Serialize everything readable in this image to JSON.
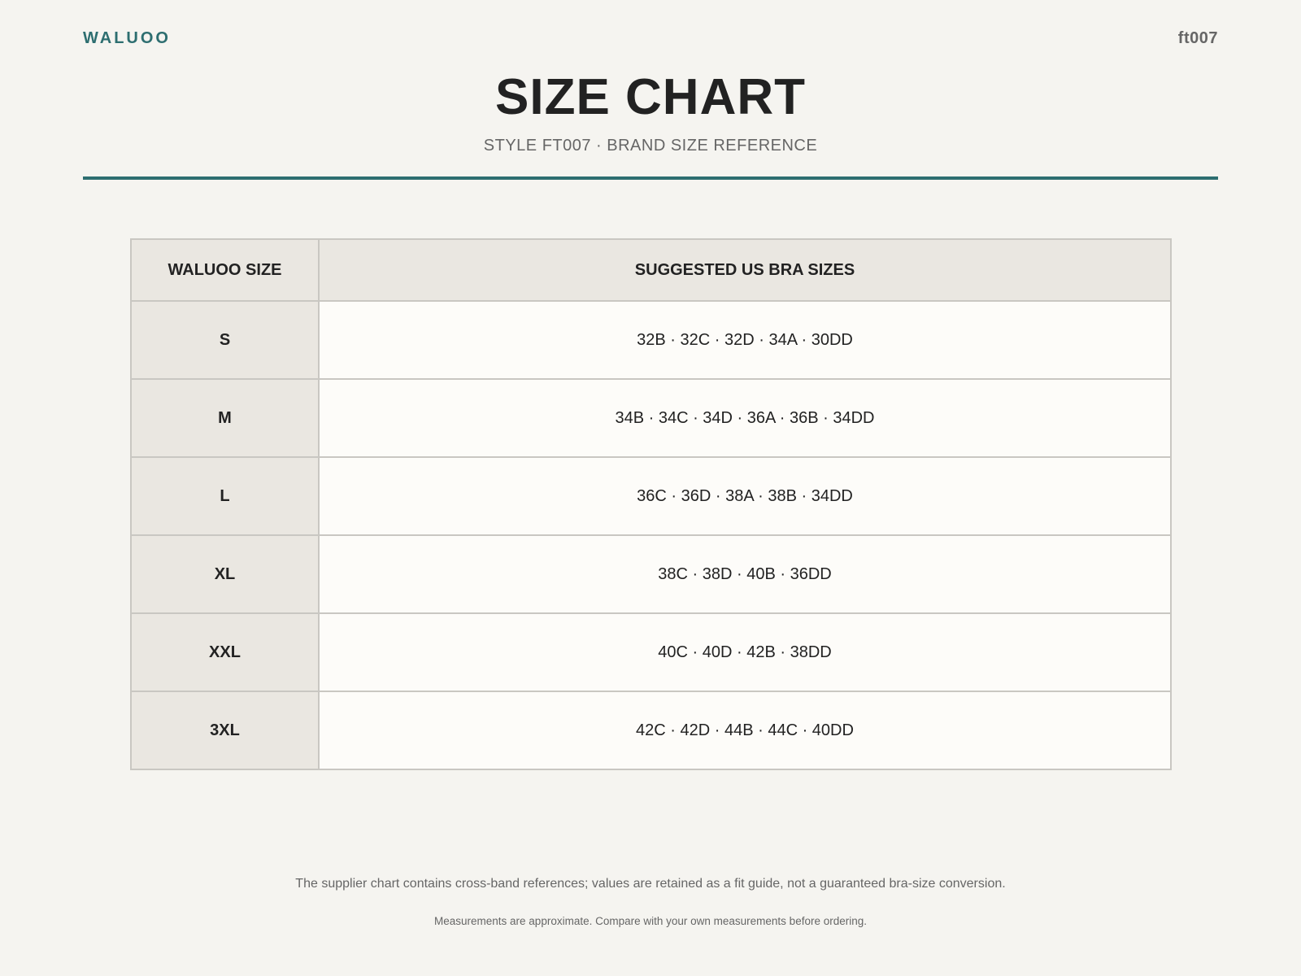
{
  "header": {
    "brand": "WALUOO",
    "style_code": "ft007"
  },
  "title": "SIZE CHART",
  "subtitle": "STYLE FT007 · BRAND SIZE REFERENCE",
  "colors": {
    "accent": "#2d6e70",
    "background": "#f5f4f0",
    "header_cell": "#eae7e1",
    "body_cell": "#fdfcf9"
  },
  "table": {
    "headers": [
      "WALUOO SIZE",
      "SUGGESTED US BRA SIZES"
    ],
    "rows": [
      {
        "size": "S",
        "bra_sizes": "32B · 32C · 32D · 34A · 30DD"
      },
      {
        "size": "M",
        "bra_sizes": "34B · 34C · 34D · 36A · 36B · 34DD"
      },
      {
        "size": "L",
        "bra_sizes": "36C · 36D · 38A · 38B · 34DD"
      },
      {
        "size": "XL",
        "bra_sizes": "38C · 38D · 40B · 36DD"
      },
      {
        "size": "XXL",
        "bra_sizes": "40C · 40D · 42B · 38DD"
      },
      {
        "size": "3XL",
        "bra_sizes": "42C · 42D · 44B · 44C · 40DD"
      }
    ]
  },
  "footer": {
    "note": "The supplier chart contains cross-band references; values are retained as a fit guide, not a guaranteed bra-size conversion.",
    "disclaimer": "Measurements are approximate. Compare with your own measurements before ordering."
  }
}
